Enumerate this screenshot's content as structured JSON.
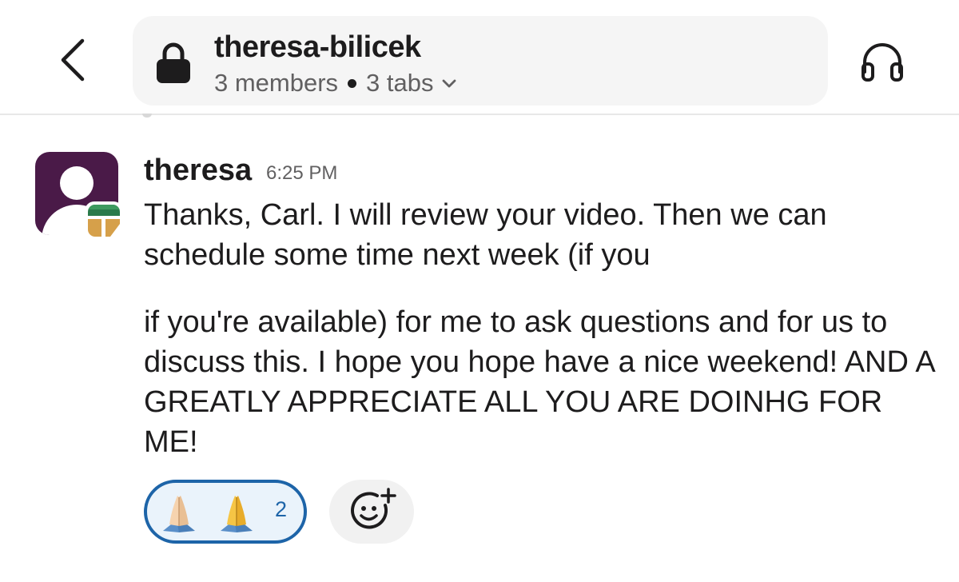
{
  "header": {
    "back_icon": "chevron-left-icon",
    "lock_icon": "lock-icon",
    "channel_name": "theresa-bilicek",
    "members": "3 members",
    "tabs": "3 tabs",
    "huddle_icon": "headphones-icon"
  },
  "message": {
    "author": "theresa",
    "time": "6:25 PM",
    "paragraph1": "Thanks, Carl. I will review your video. Then we can schedule some time next week (if you",
    "paragraph2": "if you're available) for me to ask questions and for us to discuss this. I hope you hope have a nice weekend! AND A GREATLY APPRECIATE ALL YOU ARE DOINHG FOR ME!",
    "avatar_color": "#4a1a48"
  },
  "reactions": {
    "emoji_name": "pray",
    "count": "2",
    "accent_color": "#1d64a8",
    "add_icon": "add-reaction-icon"
  }
}
